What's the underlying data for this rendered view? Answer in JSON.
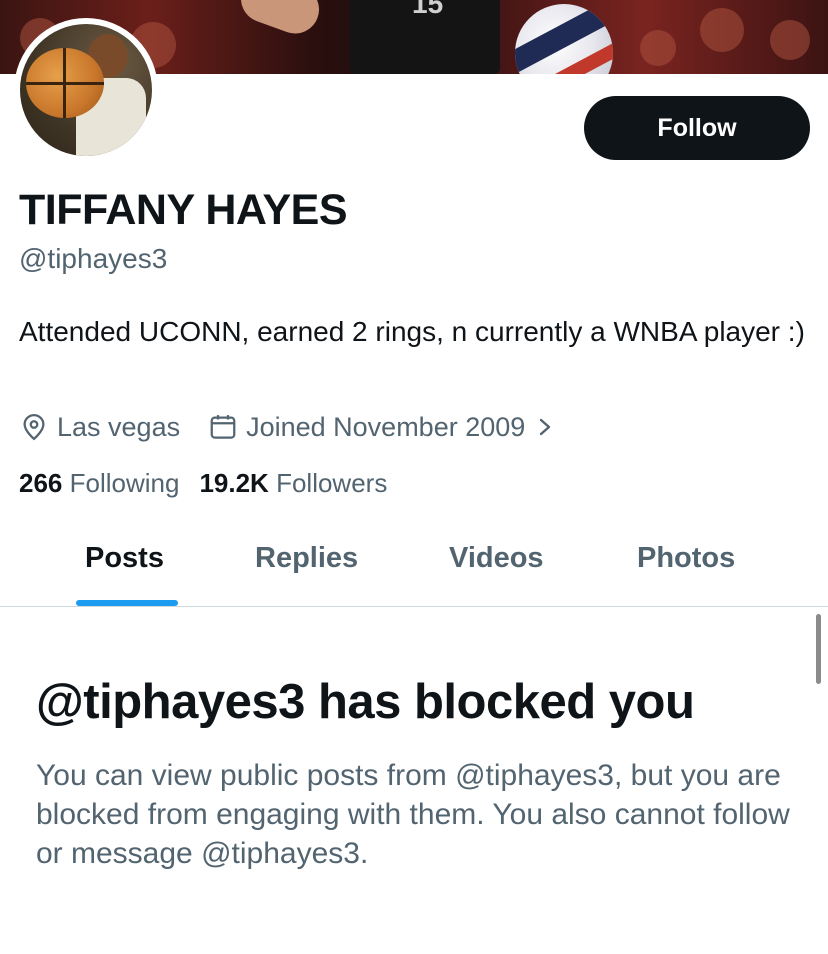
{
  "banner": {
    "jersey_number": "15"
  },
  "profile": {
    "display_name": "TIFFANY HAYES",
    "handle": "@tiphayes3",
    "bio": "Attended UCONN, earned 2 rings, n currently a WNBA player :)",
    "location": "Las vegas",
    "joined": "Joined November 2009",
    "following_count": "266",
    "following_label": "Following",
    "followers_count": "19.2K",
    "followers_label": "Followers"
  },
  "actions": {
    "follow_label": "Follow"
  },
  "tabs": [
    {
      "label": "Posts",
      "active": true
    },
    {
      "label": "Replies",
      "active": false
    },
    {
      "label": "Videos",
      "active": false
    },
    {
      "label": "Photos",
      "active": false
    }
  ],
  "blocked": {
    "title": "@tiphayes3 has blocked you",
    "message": "You can view public posts from @tiphayes3, but you are blocked from engaging with them. You also cannot follow or message @tiphayes3."
  },
  "icons": {
    "location": "location-pin-icon",
    "joined": "calendar-icon",
    "expand": "chevron-right-icon"
  },
  "colors": {
    "accent": "#1d9bf0",
    "text_primary": "#0f1419",
    "text_secondary": "#536471",
    "button_bg": "#0f1419"
  }
}
